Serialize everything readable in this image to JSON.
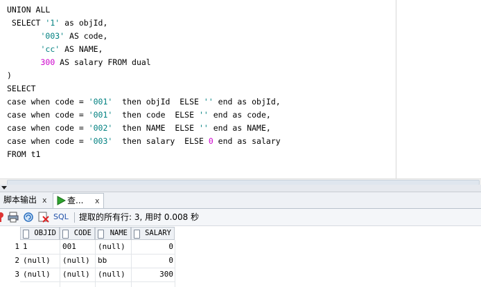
{
  "editor": {
    "lines": [
      [
        {
          "t": "UNION ALL",
          "c": "kw"
        }
      ],
      [
        {
          "t": " SELECT ",
          "c": "kw"
        },
        {
          "t": "'1'",
          "c": "str"
        },
        {
          "t": " as objId,",
          "c": "kw"
        }
      ],
      [
        {
          "t": "       ",
          "c": "kw"
        },
        {
          "t": "'003'",
          "c": "str"
        },
        {
          "t": " AS code,",
          "c": "kw"
        }
      ],
      [
        {
          "t": "       ",
          "c": "kw"
        },
        {
          "t": "'cc'",
          "c": "str"
        },
        {
          "t": " AS NAME,",
          "c": "kw"
        }
      ],
      [
        {
          "t": "       ",
          "c": "kw"
        },
        {
          "t": "300",
          "c": "num"
        },
        {
          "t": " AS salary FROM dual",
          "c": "kw"
        }
      ],
      [
        {
          "t": ")",
          "c": "kw"
        }
      ],
      [
        {
          "t": "SELECT",
          "c": "kw"
        }
      ],
      [
        {
          "t": "case when code = ",
          "c": "kw"
        },
        {
          "t": "'001'",
          "c": "str"
        },
        {
          "t": "  then objId  ELSE ",
          "c": "kw"
        },
        {
          "t": "''",
          "c": "str"
        },
        {
          "t": " end as objId,",
          "c": "kw"
        }
      ],
      [
        {
          "t": "case when code = ",
          "c": "kw"
        },
        {
          "t": "'001'",
          "c": "str"
        },
        {
          "t": "  then code  ELSE ",
          "c": "kw"
        },
        {
          "t": "''",
          "c": "str"
        },
        {
          "t": " end as code,",
          "c": "kw"
        }
      ],
      [
        {
          "t": "case when code = ",
          "c": "kw"
        },
        {
          "t": "'002'",
          "c": "str"
        },
        {
          "t": "  then NAME  ELSE ",
          "c": "kw"
        },
        {
          "t": "''",
          "c": "str"
        },
        {
          "t": " end as NAME,",
          "c": "kw"
        }
      ],
      [
        {
          "t": "case when code = ",
          "c": "kw"
        },
        {
          "t": "'003'",
          "c": "str"
        },
        {
          "t": "  then salary  ELSE ",
          "c": "kw"
        },
        {
          "t": "0",
          "c": "num"
        },
        {
          "t": " end as salary",
          "c": "kw"
        }
      ],
      [
        {
          "t": "FROM t1",
          "c": "kw"
        }
      ]
    ]
  },
  "tabs": {
    "script_output": "脚本输出",
    "query_result": "查...",
    "close": "x"
  },
  "toolbar": {
    "sql_label": "SQL",
    "status": "提取的所有行: 3, 用时 0.008 秒"
  },
  "grid": {
    "columns": [
      "OBJID",
      "CODE",
      "NAME",
      "SALARY"
    ],
    "rows": [
      {
        "n": "1",
        "cells": [
          "1",
          "001",
          "(null)",
          "0"
        ]
      },
      {
        "n": "2",
        "cells": [
          "(null)",
          "(null)",
          "bb",
          "0"
        ]
      },
      {
        "n": "3",
        "cells": [
          "(null)",
          "(null)",
          "(null)",
          "300"
        ]
      }
    ]
  },
  "colors": {
    "string": "#008080",
    "number": "#cc00cc",
    "link": "#1f4fa8"
  },
  "icons": [
    "pin-icon",
    "print-icon",
    "refresh-icon",
    "export-icon",
    "arrow-collapse-icon",
    "run-icon"
  ]
}
